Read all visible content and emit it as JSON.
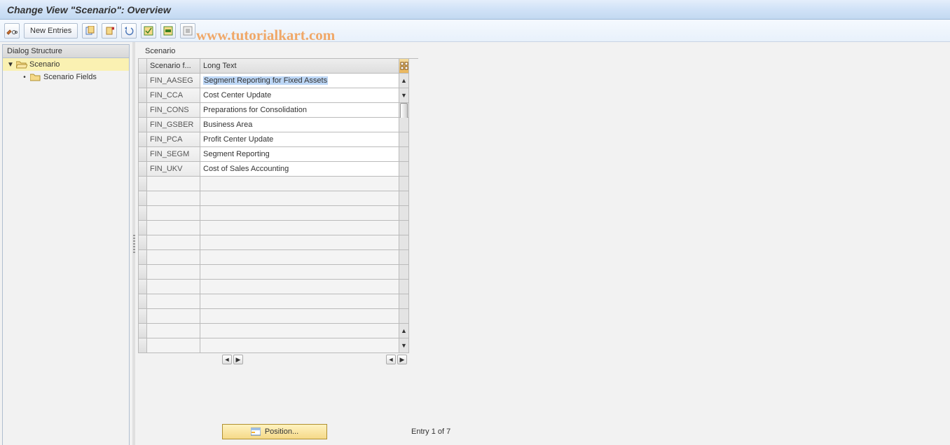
{
  "title": "Change View \"Scenario\": Overview",
  "watermark": "www.tutorialkart.com",
  "toolbar": {
    "new_entries_label": "New Entries"
  },
  "dialog_structure": {
    "header": "Dialog Structure",
    "items": [
      {
        "label": "Scenario",
        "level": 1,
        "open": true,
        "selected": true
      },
      {
        "label": "Scenario Fields",
        "level": 2,
        "open": false,
        "selected": false
      }
    ]
  },
  "table": {
    "title": "Scenario",
    "columns": [
      "Scenario f...",
      "Long Text"
    ],
    "rows": [
      {
        "code": "FIN_AASEG",
        "text": "Segment Reporting for Fixed Assets",
        "selected": true
      },
      {
        "code": "FIN_CCA",
        "text": "Cost Center Update"
      },
      {
        "code": "FIN_CONS",
        "text": "Preparations for Consolidation"
      },
      {
        "code": "FIN_GSBER",
        "text": "Business Area"
      },
      {
        "code": "FIN_PCA",
        "text": "Profit Center Update"
      },
      {
        "code": "FIN_SEGM",
        "text": "Segment Reporting"
      },
      {
        "code": "FIN_UKV",
        "text": "Cost of Sales Accounting"
      }
    ],
    "empty_rows": 12
  },
  "footer": {
    "position_label": "Position...",
    "entry_text": "Entry 1 of 7"
  }
}
